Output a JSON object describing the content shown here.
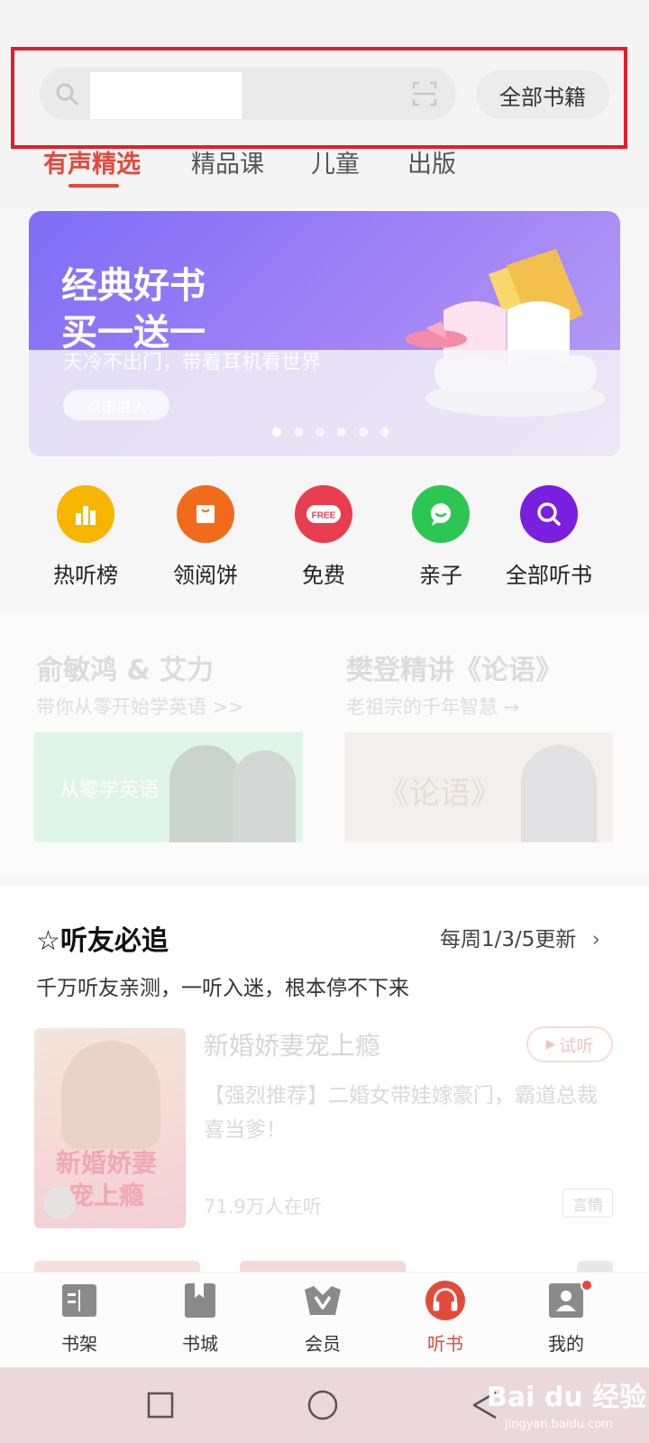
{
  "header": {
    "search_placeholder": "",
    "all_books_label": "全部书籍"
  },
  "tabs": [
    {
      "label": "有声精选",
      "active": true
    },
    {
      "label": "精品课",
      "active": false
    },
    {
      "label": "儿童",
      "active": false
    },
    {
      "label": "出版",
      "active": false
    }
  ],
  "banner": {
    "title_line1": "经典好书",
    "title_line2": "买一送一",
    "subtitle": "天冷不出门，带着耳机看世界",
    "button_label": "点击进入",
    "page_count": 6,
    "current_page": 1
  },
  "categories": [
    {
      "label": "热听榜",
      "icon": "chart-icon",
      "color": "#f7b500"
    },
    {
      "label": "领阅饼",
      "icon": "gift-box-icon",
      "color": "#f26b1d"
    },
    {
      "label": "免费",
      "icon": "free-icon",
      "color": "#e83d4f",
      "badge_text": "FREE"
    },
    {
      "label": "亲子",
      "icon": "chat-icon",
      "color": "#2dc653"
    },
    {
      "label": "全部听书",
      "icon": "search-icon",
      "color": "#7a1ee0"
    }
  ],
  "promos": [
    {
      "title": "俞敏鸿 & 艾力",
      "subtitle": "带你从零开始学英语 >>",
      "image_text": "从零学英语"
    },
    {
      "title": "樊登精讲《论语》",
      "subtitle": "老祖宗的千年智慧 →",
      "image_text": "《论语》"
    }
  ],
  "section": {
    "title": "☆听友必追",
    "update_label": "每周1/3/5更新",
    "description": "千万听友亲测，一听入迷，根本停不下来",
    "book": {
      "title": "新婚娇妻宠上瘾",
      "description": "【强烈推荐】二婚女带娃嫁豪门，霸道总裁喜当爹！",
      "listeners": "71.9万人在听",
      "try_label": "试听",
      "genre": "言情",
      "cover_text_line1": "新婚娇妻",
      "cover_text_line2": "宠上瘾"
    }
  },
  "bottom_nav": [
    {
      "label": "书架",
      "icon": "bookshelf-icon",
      "active": false
    },
    {
      "label": "书城",
      "icon": "bookmark-icon",
      "active": false
    },
    {
      "label": "会员",
      "icon": "vip-crown-icon",
      "active": false
    },
    {
      "label": "听书",
      "icon": "headphones-icon",
      "active": true
    },
    {
      "label": "我的",
      "icon": "profile-icon",
      "active": false
    }
  ],
  "watermark": {
    "text": "Bai du 经验",
    "sub": "jingyan.baidu.com"
  },
  "colors": {
    "accent": "#e24a3b",
    "highlight_box": "#e41e26"
  }
}
